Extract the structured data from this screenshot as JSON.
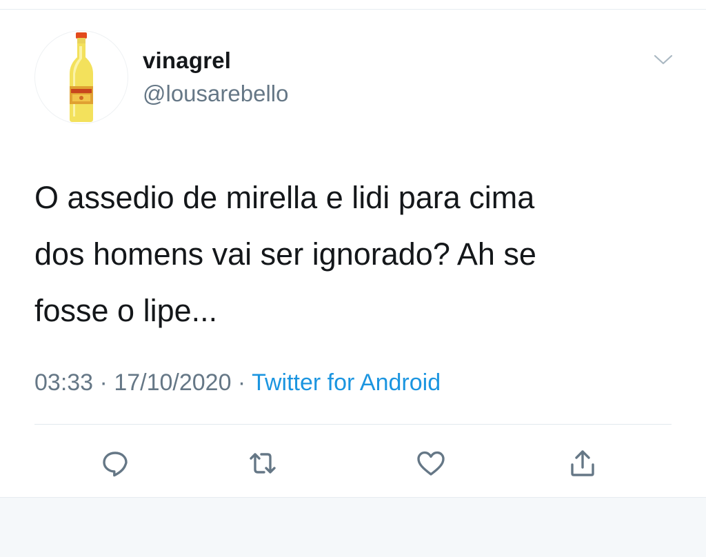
{
  "author": {
    "display_name": "vinagrel",
    "handle": "@lousarebello",
    "avatar_icon": "vinegar-bottle-icon"
  },
  "tweet": {
    "text": "O assedio de mirella e lidi para cima\ndos homens vai ser ignorado? Ah se\nfosse o lipe...",
    "time": "03:33",
    "separator": " · ",
    "date": "17/10/2020",
    "source": "Twitter for Android"
  },
  "actions": {
    "reply_icon": "reply-icon",
    "retweet_icon": "retweet-icon",
    "like_icon": "heart-icon",
    "share_icon": "share-icon",
    "menu_icon": "chevron-down-icon"
  },
  "colors": {
    "text": "#14171a",
    "secondary": "#657786",
    "link": "#1b95e0",
    "icon": "#657786",
    "divider": "#e1e8ed",
    "footer_bg": "#f5f8fa"
  }
}
